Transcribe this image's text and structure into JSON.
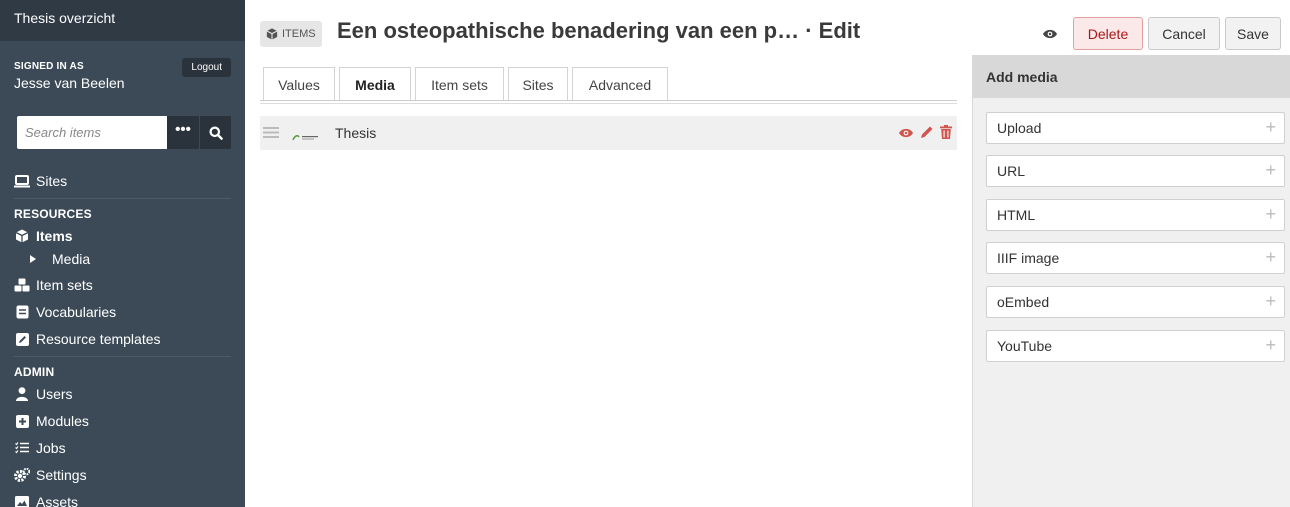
{
  "sidebar": {
    "brand": "Thesis overzicht",
    "signed_in_as": "SIGNED IN AS",
    "user_name": "Jesse van Beelen",
    "logout": "Logout",
    "search_placeholder": "Search items",
    "more": "•••",
    "sites": "Sites",
    "resources_heading": "RESOURCES",
    "items": "Items",
    "media": "Media",
    "item_sets": "Item sets",
    "vocabularies": "Vocabularies",
    "resource_templates": "Resource templates",
    "admin_heading": "ADMIN",
    "users": "Users",
    "modules": "Modules",
    "jobs": "Jobs",
    "settings": "Settings",
    "assets": "Assets"
  },
  "header": {
    "items_tag": "ITEMS",
    "title": "Een osteopathische benadering van een p…  ·  Edit",
    "delete": "Delete",
    "cancel": "Cancel",
    "save": "Save"
  },
  "tabs": [
    "Values",
    "Media",
    "Item sets",
    "Sites",
    "Advanced"
  ],
  "media_row": {
    "label": "Thesis"
  },
  "panel": {
    "title": "Add media",
    "buttons": [
      "Upload",
      "URL",
      "HTML",
      "IIIF image",
      "oEmbed",
      "YouTube"
    ],
    "plus": "+"
  },
  "colors": {
    "sidebar": "#3c4a57",
    "delete": "#a91919",
    "action_red": "#d0554e"
  }
}
